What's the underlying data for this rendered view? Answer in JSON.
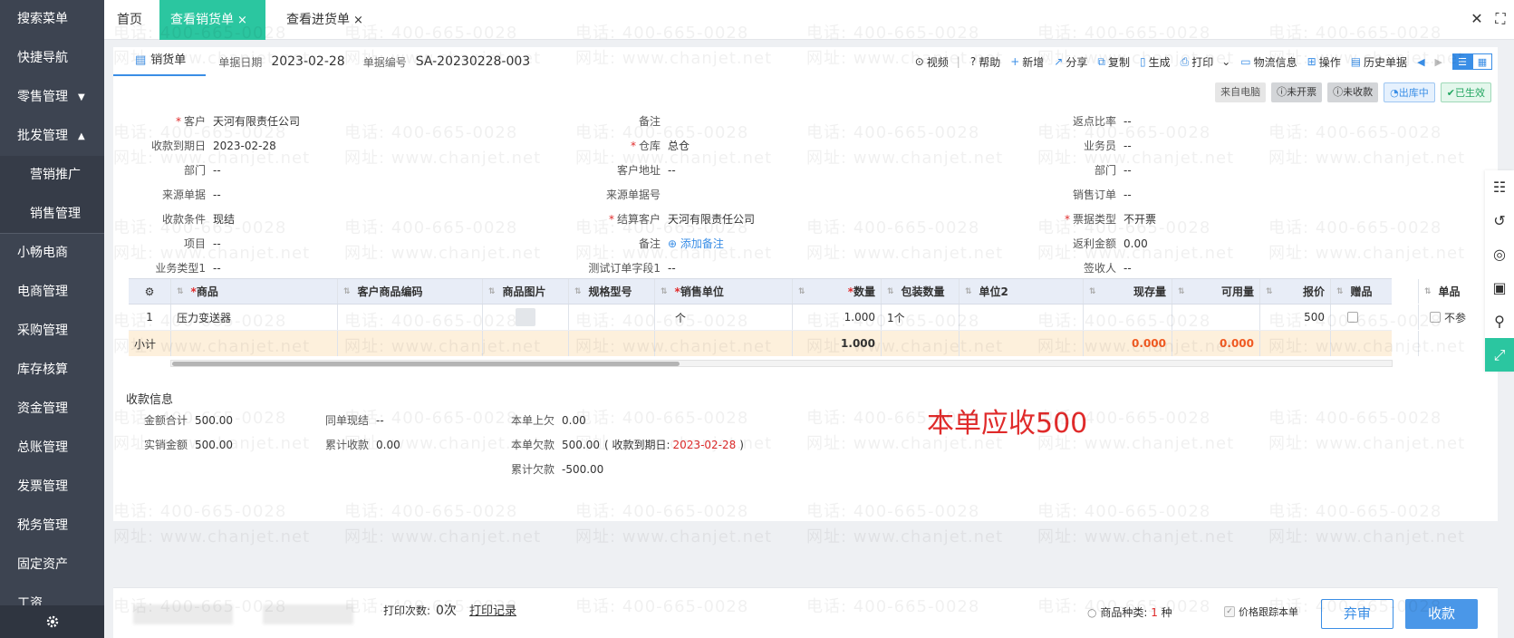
{
  "sidebar": {
    "items": [
      {
        "label": "搜索菜单"
      },
      {
        "label": "快捷导航"
      },
      {
        "label": "零售管理",
        "caret": "▼"
      },
      {
        "label": "批发管理",
        "caret": "▲"
      },
      {
        "label": "营销推广"
      },
      {
        "label": "销售管理"
      },
      {
        "label": "小畅电商"
      },
      {
        "label": "电商管理"
      },
      {
        "label": "采购管理"
      },
      {
        "label": "库存核算"
      },
      {
        "label": "资金管理"
      },
      {
        "label": "总账管理"
      },
      {
        "label": "发票管理"
      },
      {
        "label": "税务管理"
      },
      {
        "label": "固定资产"
      },
      {
        "label": "工资"
      }
    ]
  },
  "tabs": {
    "home": "首页",
    "sales": "查看销货单",
    "purchase": "查看进货单",
    "close_mark": "×"
  },
  "doc": {
    "tab_label": "销货单",
    "date_label": "单据日期",
    "date_value": "2023-02-28",
    "no_label": "单据编号",
    "no_value": "SA-20230228-003"
  },
  "toolbar": {
    "video": "视频",
    "help": "帮助",
    "add": "新增",
    "share": "分享",
    "copy": "复制",
    "generate": "生成",
    "print": "打印",
    "logistics": "物流信息",
    "operate": "操作",
    "history": "历史单据"
  },
  "badges": {
    "source": "来自电脑",
    "invoice": "未开票",
    "receipt": "未收款",
    "outbound": "出库中",
    "effective": "已生效"
  },
  "form": {
    "col1": [
      {
        "label": "客户",
        "required": "*",
        "value": "天河有限责任公司"
      },
      {
        "label": "收款到期日",
        "required": "",
        "value": "2023-02-28"
      },
      {
        "label": "部门",
        "required": "",
        "value": "--"
      },
      {
        "label": "来源单据",
        "required": "",
        "value": "--"
      },
      {
        "label": "收款条件",
        "required": "",
        "value": "现结"
      },
      {
        "label": "项目",
        "required": "",
        "value": "--"
      },
      {
        "label": "业务类型1",
        "required": "",
        "value": "--"
      }
    ],
    "col2": [
      {
        "label": "备注",
        "required": "",
        "value": ""
      },
      {
        "label": "仓库",
        "required": "*",
        "value": "总仓"
      },
      {
        "label": "客户地址",
        "required": "",
        "value": "--"
      },
      {
        "label": "来源单据号",
        "required": "",
        "value": ""
      },
      {
        "label": "结算客户",
        "required": "*",
        "value": "天河有限责任公司"
      },
      {
        "label": "备注",
        "required": "",
        "value": "",
        "link": "添加备注"
      },
      {
        "label": "测试订单字段1",
        "required": "",
        "value": "--"
      }
    ],
    "col3": [
      {
        "label": "返点比率",
        "required": "",
        "value": "--"
      },
      {
        "label": "业务员",
        "required": "",
        "value": "--"
      },
      {
        "label": "部门",
        "required": "",
        "value": "--"
      },
      {
        "label": "销售订单",
        "required": "",
        "value": "--"
      },
      {
        "label": "票据类型",
        "required": "*",
        "value": "不开票"
      },
      {
        "label": "返利金额",
        "required": "",
        "value": "0.00"
      },
      {
        "label": "签收人",
        "required": "",
        "value": "--"
      }
    ]
  },
  "table": {
    "headers": [
      "商品",
      "客户商品编码",
      "商品图片",
      "规格型号",
      "销售单位",
      "数量",
      "包装数量",
      "单位2",
      "现存量",
      "可用量",
      "报价",
      "赠品",
      "单品"
    ],
    "row": {
      "index": "1",
      "product": "压力变送器",
      "unit": "个",
      "qty": "1.000",
      "pack_qty": "1个",
      "price": "500",
      "single_text": "不参"
    },
    "subtotal": {
      "label": "小计",
      "qty": "1.000",
      "stock": "0.000",
      "available": "0.000"
    }
  },
  "payment": {
    "title": "收款信息",
    "amount_total_label": "金额合计",
    "amount_total": "500.00",
    "actual_label": "实销金额",
    "actual": "500.00",
    "cash_label": "同单现结",
    "cash": "--",
    "cum_recv_label": "累计收款",
    "cum_recv": "0.00",
    "prev_owe_label": "本单上欠",
    "prev_owe": "0.00",
    "this_owe_label": "本单欠款",
    "this_owe": "500.00",
    "due_prefix": "( 收款到期日:",
    "due_date": "2023-02-28",
    "due_suffix": ")",
    "cum_owe_label": "累计欠款",
    "cum_owe": "-500.00"
  },
  "annotation": "本单应收500",
  "bottom": {
    "print_count_label": "打印次数:",
    "print_count": "0次",
    "print_record": "打印记录",
    "kinds_label": "商品种类:",
    "kinds_value": "1",
    "kinds_unit": "种",
    "price_track": "价格跟踪本单",
    "abandon": "弃审",
    "collect": "收款"
  },
  "watermark": {
    "phone": "电话: 400-665-0028",
    "site": "网址: www.chanjet.net"
  },
  "colors": {
    "accent_teal": "#2bc6a0",
    "accent_blue": "#3a8ee6",
    "sidebar_bg": "#3d4451",
    "alert_red": "#e02b2b"
  }
}
